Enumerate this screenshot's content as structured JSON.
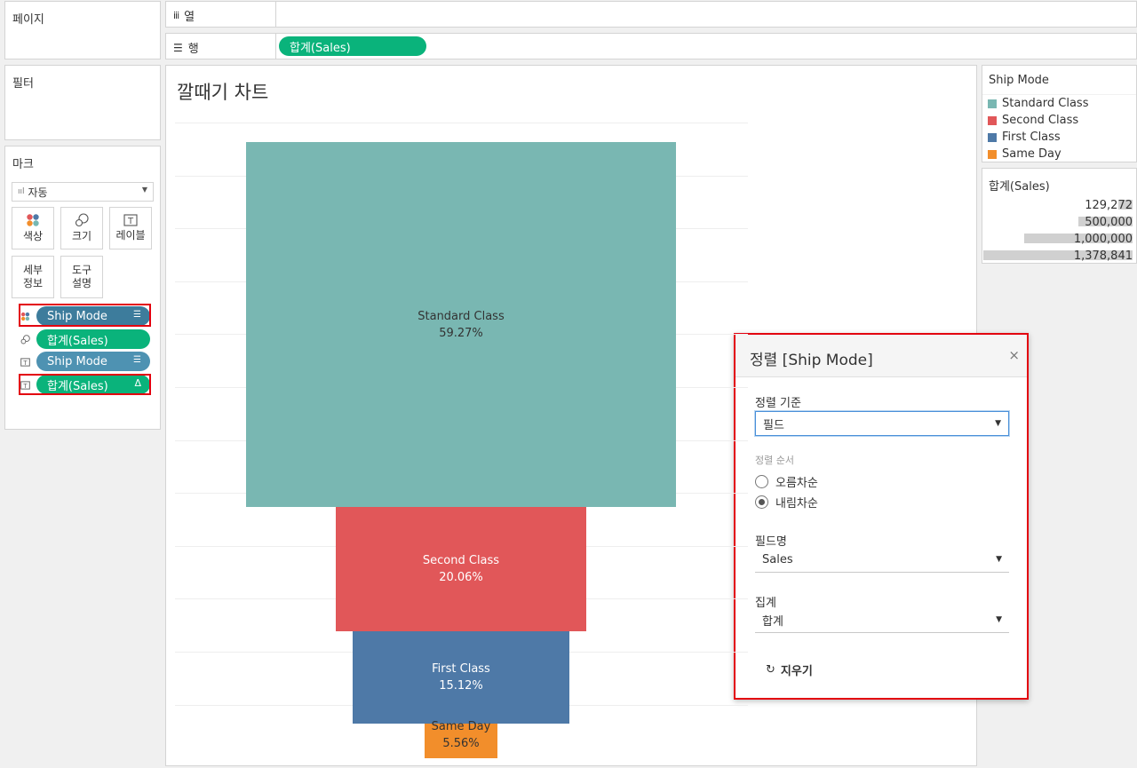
{
  "left": {
    "pages_title": "페이지",
    "filters_title": "필터",
    "marks": {
      "title": "마크",
      "mark_type": "자동",
      "buttons": {
        "color": "색상",
        "size": "크기",
        "label": "레이블",
        "detail_line1": "세부",
        "detail_line2": "정보",
        "tooltip_line1": "도구",
        "tooltip_line2": "설명"
      },
      "fields": [
        {
          "label": "Ship Mode",
          "icon": "color-dots-icon"
        },
        {
          "label": "합계(Sales)",
          "icon": "size-icon"
        },
        {
          "label": "Ship Mode",
          "icon": "text-label-icon"
        },
        {
          "label": "합계(Sales)",
          "icon": "text-label-icon",
          "badge": "Δ"
        }
      ]
    }
  },
  "shelves": {
    "columns_label": "열",
    "rows_label": "행",
    "rows_pill": "합계(Sales)"
  },
  "view": {
    "title": "깔때기 차트"
  },
  "chart_data": {
    "type": "bar",
    "categories": [
      "Standard Class",
      "Second Class",
      "First Class",
      "Same Day"
    ],
    "percent_labels": [
      "59.27%",
      "20.06%",
      "15.12%",
      "5.56%"
    ],
    "values": [
      1378841,
      466671,
      351750,
      129272
    ],
    "colors": [
      "#79b7b2",
      "#e15759",
      "#4e79a7",
      "#f28e2b"
    ]
  },
  "legend": {
    "title": "Ship Mode",
    "items": [
      {
        "label": "Standard Class",
        "color": "#79b7b2"
      },
      {
        "label": "Second Class",
        "color": "#e15759"
      },
      {
        "label": "First Class",
        "color": "#4e79a7"
      },
      {
        "label": "Same Day",
        "color": "#f28e2b"
      }
    ]
  },
  "size_legend": {
    "title": "합계(Sales)",
    "values": [
      "129,272",
      "500,000",
      "1,000,000",
      "1,378,841"
    ],
    "fractions": [
      0.094,
      0.363,
      0.725,
      1.0
    ]
  },
  "sort_dialog": {
    "title": "정렬 [Ship Mode]",
    "close_icon": "×",
    "sort_by_label": "정렬 기준",
    "sort_by_value": "필드",
    "sort_order_label": "정렬 순서",
    "ascending": "오름차순",
    "descending": "내림차순",
    "selected_order": "descending",
    "field_name_label": "필드명",
    "field_name_value": "Sales",
    "aggregation_label": "집계",
    "aggregation_value": "합계",
    "clear_label": "지우기"
  }
}
